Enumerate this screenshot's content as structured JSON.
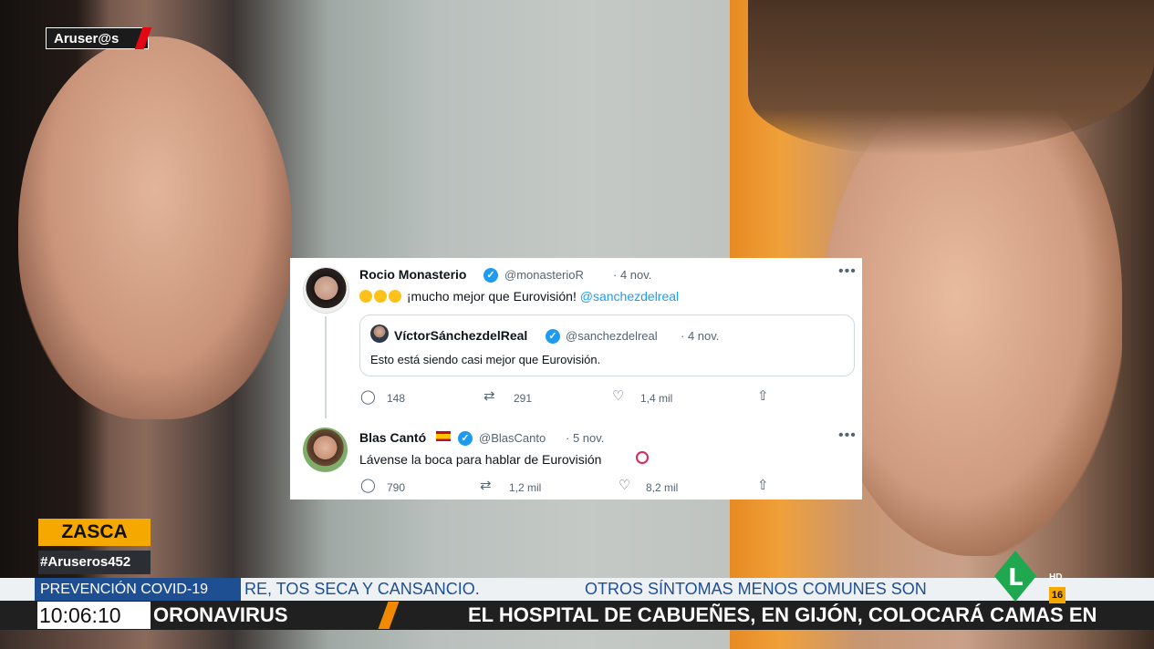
{
  "brand": {
    "logo": "Aruser@s"
  },
  "tweets": [
    {
      "name": "Rocio Monasterio",
      "handle": "@monasterioR",
      "date": "· 4 nov.",
      "text": "¡mucho mejor que Eurovisión!",
      "mention": "@sanchezdelreal",
      "quote": {
        "name": "VíctorSánchezdelReal",
        "handle": "@sanchezdelreal",
        "date": "· 4 nov.",
        "text": "Esto está siendo casi mejor que Eurovisión."
      },
      "replies": "148",
      "retweets": "291",
      "likes": "1,4 mil"
    },
    {
      "name": "Blas Cantó",
      "handle": "@BlasCanto",
      "date": "· 5 nov.",
      "text": "Lávense la boca para hablar de Eurovisión",
      "replies": "790",
      "retweets": "1,2 mil",
      "likes": "8,2 mil"
    }
  ],
  "overlay": {
    "tag": "ZASCA",
    "hashtag": "#Aruseros452",
    "section": "PREVENCIÓN COVID-19",
    "ticker_top": "RE, TOS SECA Y CANSANCIO.",
    "ticker_top_2": "OTROS SÍNTOMAS MENOS COMUNES SON",
    "clock": "10:06:10",
    "ticker_bottom": "ORONAVIRUS",
    "ticker_bottom_2": "EL HOSPITAL DE CABUEÑES, EN GIJÓN, COLOCARÁ CAMAS EN",
    "channel_hd": "HD",
    "age_rating": "16"
  }
}
